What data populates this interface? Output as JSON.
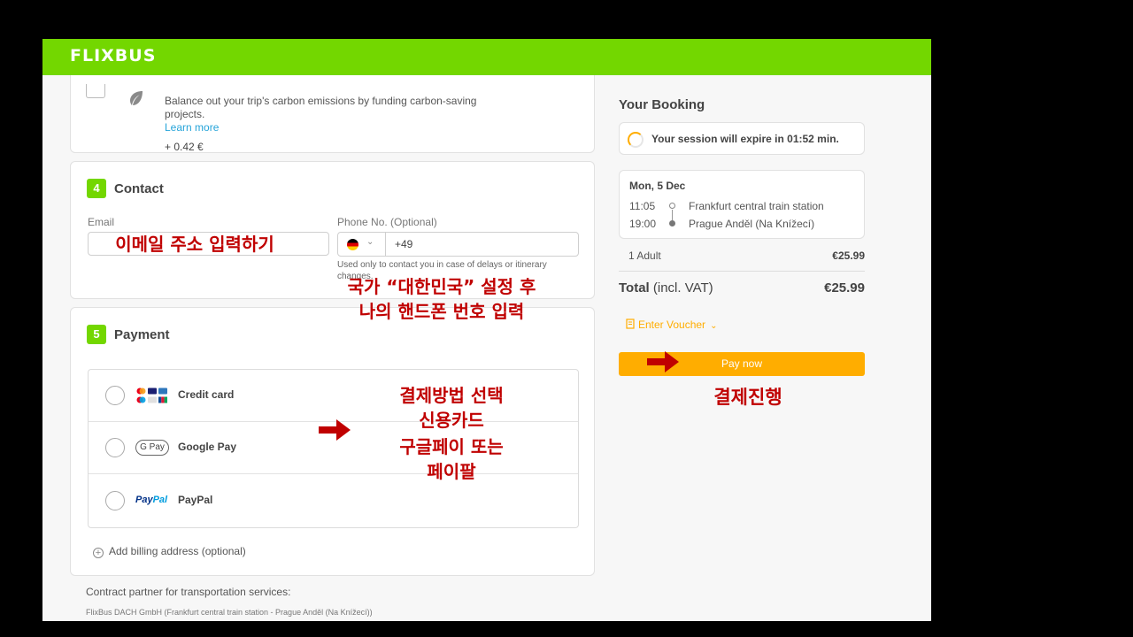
{
  "header": {
    "logo": "FLIXBUS"
  },
  "carbon": {
    "description": "Balance out your trip's carbon emissions by funding carbon-saving projects.",
    "link": "Learn more",
    "price": "+ 0.42 €"
  },
  "contact": {
    "step": "4",
    "title": "Contact",
    "email_label": "Email",
    "phone_label": "Phone No. (Optional)",
    "phone_value": "+49",
    "phone_hint": "Used only to contact you in case of delays or itinerary changes."
  },
  "payment": {
    "step": "5",
    "title": "Payment",
    "options": [
      {
        "label": "Credit card"
      },
      {
        "label": "Google Pay",
        "badge": "G Pay"
      },
      {
        "label": "PayPal"
      }
    ],
    "billing": "Add billing address (optional)"
  },
  "footer": {
    "contract_title": "Contract partner for transportation services:",
    "contract_detail": "FlixBus DACH GmbH (Frankfurt central train station - Prague Anděl (Na Knížecí))"
  },
  "booking": {
    "title": "Your Booking",
    "session": "Your session will expire in 01:52 min.",
    "trip": {
      "date": "Mon, 5 Dec",
      "depart_time": "11:05",
      "depart_station": "Frankfurt central train station",
      "arrive_time": "19:00",
      "arrive_station": "Prague Anděl (Na Knížecí)"
    },
    "passengers": "1 Adult",
    "passengers_price": "€25.99",
    "total_label": "Total",
    "total_suffix": " (incl. VAT)",
    "total_price": "€25.99",
    "voucher": "Enter Voucher",
    "pay_button": "Pay now"
  },
  "annotations": {
    "email": "이메일 주소 입력하기",
    "phone_line1": "국가 “대한민국” 설정 후",
    "phone_line2": "나의 핸드폰 번호 입력",
    "method_line1": "결제방법 선택",
    "method_line2": "신용카드",
    "method_line3": "구글페이 또는",
    "method_line4": "페이팔",
    "pay": "결제진행",
    "color": "#c00000"
  },
  "colors": {
    "brand_green": "#73d700",
    "accent_orange": "#ffad00",
    "link_blue": "#26a4d9"
  }
}
